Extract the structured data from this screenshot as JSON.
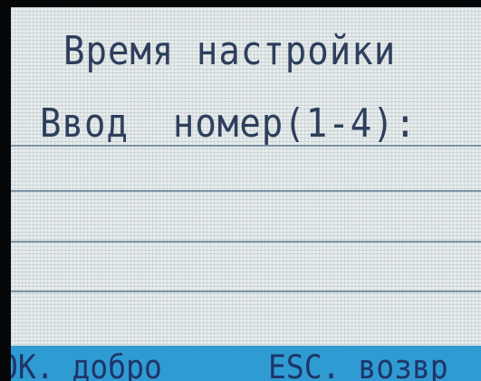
{
  "screen": {
    "title": "Время настройки",
    "prompt": "Ввод  номер(1-4):"
  },
  "input_rows": [
    {
      "value": ""
    },
    {
      "value": ""
    },
    {
      "value": ""
    },
    {
      "value": ""
    }
  ],
  "softkeys": {
    "ok_label": "OK. добро",
    "esc_label": "ESC. возвр"
  },
  "colors": {
    "background": "#e7ecec",
    "text": "#2d3f5c",
    "footer": "#2f9bd3",
    "footer_text": "#1f3568",
    "rule": "#7e95a8"
  }
}
